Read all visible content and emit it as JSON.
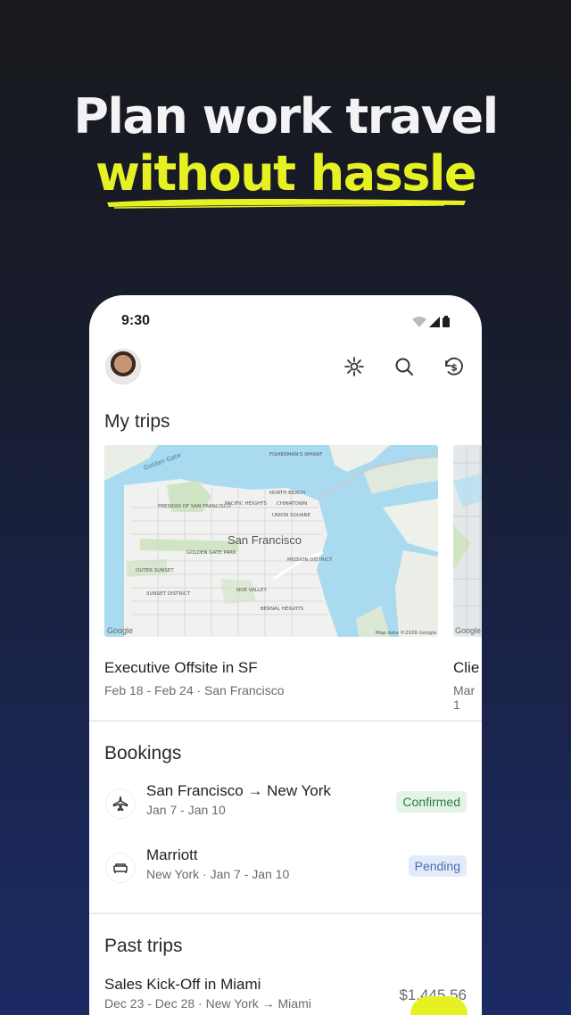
{
  "headline": {
    "line1": "Plan work travel",
    "line2": "without hassle",
    "accent_color": "#e6f123"
  },
  "status_bar": {
    "time": "9:30",
    "icons": [
      "wifi-icon",
      "signal-icon",
      "battery-icon"
    ]
  },
  "toolbar": {
    "icons": [
      "sparkle-icon",
      "search-icon",
      "spend-history-icon"
    ]
  },
  "my_trips": {
    "title": "My trips",
    "cards": [
      {
        "title": "Executive Offsite in SF",
        "subtitle": "Feb 18 - Feb 24 · San Francisco",
        "map": {
          "city_label": "San Francisco",
          "attribution": "Map data ©2026 Google",
          "logo": "Google",
          "labels": [
            "Golden Gate",
            "FISHERMAN'S WHARF",
            "NORTH BEACH",
            "PRESIDIO OF SAN FRANCISCO",
            "PACIFIC HEIGHTS",
            "CHINATOWN",
            "UNION SQUARE",
            "GOLDEN GATE PARK",
            "MISSION DISTRICT",
            "OUTER SUNSET",
            "SUNSET DISTRICT",
            "NOE VALLEY",
            "BERNAL HEIGHTS"
          ]
        }
      },
      {
        "title": "Clie",
        "subtitle": "Mar 1"
      }
    ]
  },
  "bookings": {
    "title": "Bookings",
    "items": [
      {
        "icon": "plane-icon",
        "title": "San Francisco → New York",
        "subtitle": "Jan 7 - Jan 10",
        "status": "Confirmed"
      },
      {
        "icon": "bed-icon",
        "title": "Marriott",
        "subtitle": "New York · Jan 7 - Jan 10",
        "status": "Pending"
      }
    ]
  },
  "past_trips": {
    "title": "Past trips",
    "items": [
      {
        "title": "Sales Kick-Off in Miami",
        "subtitle": "Dec 23 - Dec 28 · New York → Miami",
        "amount": "$1,445.56"
      }
    ]
  }
}
